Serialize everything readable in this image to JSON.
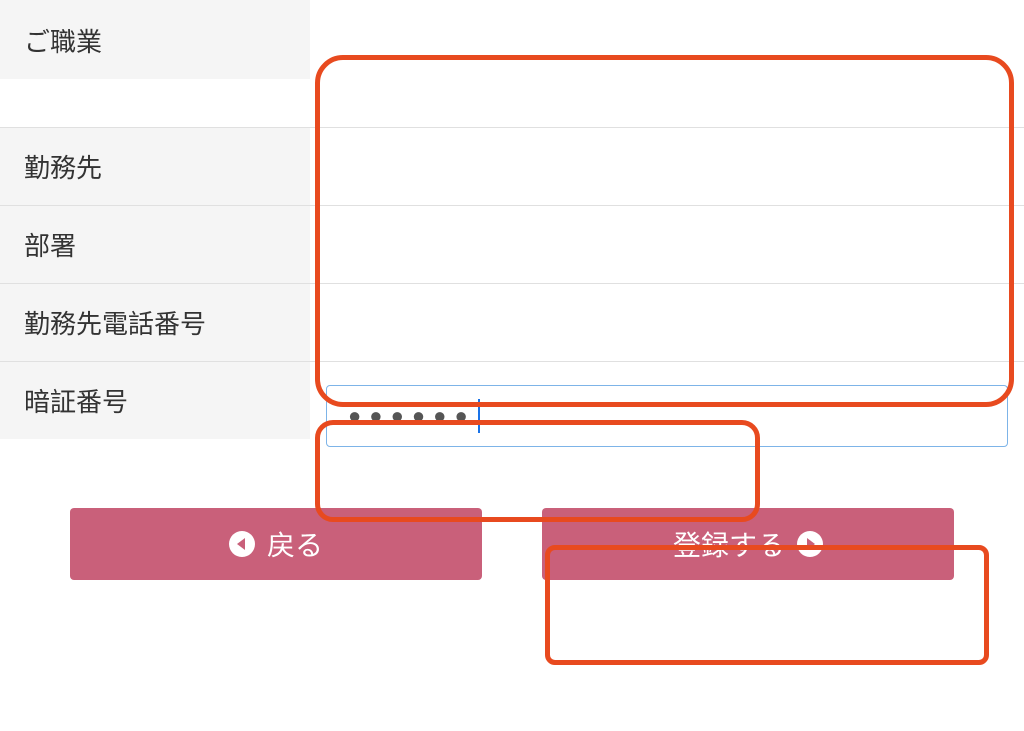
{
  "form": {
    "rows": [
      {
        "label": "ご職業",
        "value": ""
      },
      {
        "label": "勤務先",
        "value": ""
      },
      {
        "label": "部署",
        "value": ""
      },
      {
        "label": "勤務先電話番号",
        "value": ""
      }
    ],
    "pin": {
      "label": "暗証番号",
      "masked_value": "●●●●●●"
    }
  },
  "buttons": {
    "back_label": "戻る",
    "submit_label": "登録する"
  }
}
